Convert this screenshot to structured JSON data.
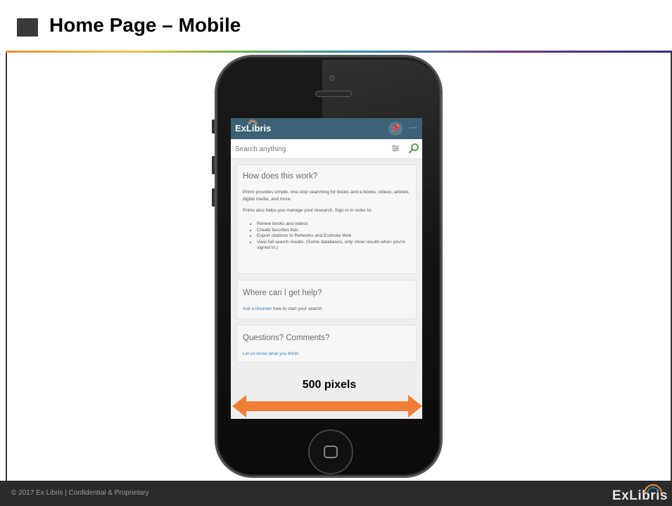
{
  "slide": {
    "title": "Home Page – Mobile",
    "footer_text": "© 2017 Ex Libris | Confidential & Proprietary",
    "footer_logo": "ExLibris"
  },
  "app": {
    "logo": "ExLibris",
    "search": {
      "placeholder": "Search anything"
    },
    "cards": [
      {
        "title": "How does this work?",
        "paragraphs": [
          "Primo provides simple, one-stop searching for books and e-books, videos, articles, digital media, and more.",
          "Primo also helps you manage your research. Sign-in in order to:"
        ],
        "list": [
          "Renew books and videos",
          "Create favorites lists",
          "Export citations to Refworks and Endnote Web",
          "View full search results. (Some databases, only show results when you're signed in.)"
        ]
      },
      {
        "title": "Where can I get help?",
        "link_text": "Ask a librarian",
        "rest_text": " how to start your search"
      },
      {
        "title": "Questions? Comments?",
        "link_text": "Let us know what you think!"
      }
    ]
  },
  "annotation": {
    "width_label": "500 pixels"
  },
  "colors": {
    "header": "#3d6175",
    "arrow": "#f07f35",
    "link": "#3a7fbf",
    "search_icon": "#4aa041"
  },
  "icons": {
    "pin": "pin-icon",
    "more": "more-icon",
    "filter": "filter-icon",
    "search": "search-icon",
    "home": "home-button-icon"
  }
}
